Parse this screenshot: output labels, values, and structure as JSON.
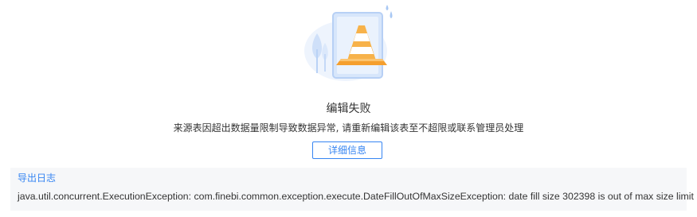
{
  "dialog": {
    "title": "编辑失败",
    "message": "来源表因超出数据量限制导致数据异常, 请重新编辑该表至不超限或联系管理员处理",
    "details_button": "详细信息",
    "illustration_icon": "traffic-cone-error-icon"
  },
  "log": {
    "export_label": "导出日志",
    "text": "java.util.concurrent.ExecutionException: com.finebi.common.exception.execute.DateFillOutOfMaxSizeException: date fill size 302398 is out of max size limit"
  },
  "colors": {
    "accent": "#3685f2",
    "cone_orange": "#f7b24a",
    "illustration_blue": "#c9defa",
    "log_background": "#f6f7f9"
  }
}
